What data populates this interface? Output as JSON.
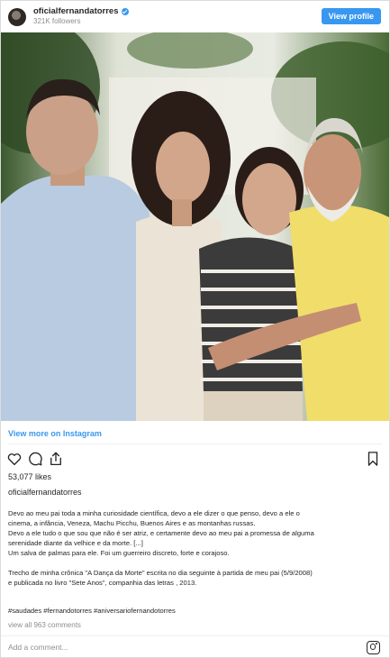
{
  "header": {
    "username": "oficialfernandatorres",
    "followers": "321K followers",
    "view_profile_label": "View profile"
  },
  "icons": {
    "avatar": "profile-avatar",
    "verified": "verified-badge-icon",
    "like": "heart-icon",
    "comment": "comment-bubble-icon",
    "share": "share-icon",
    "save": "bookmark-icon",
    "instagram": "instagram-logo-icon"
  },
  "colors": {
    "accent": "#3897f0",
    "text": "#262626",
    "muted": "#8e8e8e"
  },
  "post": {
    "view_more": "View more on Instagram",
    "likes": "53,077 likes",
    "owner": "oficialfernandatorres",
    "caption_lines": [
      "Devo ao meu pai toda a minha curiosidade científica, devo a ele dizer o que penso, devo a ele o",
      "cinema, a infância, Veneza, Machu Picchu, Buenos Aires e as montanhas russas.",
      "Devo a ele tudo o que sou que não é ser atriz, e certamente devo ao meu pai a promessa de alguma",
      "serenidade diante da velhice e da morte. [...]",
      "Um salva de palmas para ele. Foi um guerreiro discreto, forte e corajoso.",
      "",
      "Trecho de minha crônica \"A Dança da Morte\" escrita no dia seguinte à partida de meu pai (5/9/2008)",
      "e publicada no livro \"Sete Anos\", companhia das letras , 2013."
    ],
    "hashtags": "#saudades #fernandotorres #aniversariofernandotorres",
    "comments_link": "view all 963 comments",
    "add_comment_placeholder": "Add a comment..."
  }
}
